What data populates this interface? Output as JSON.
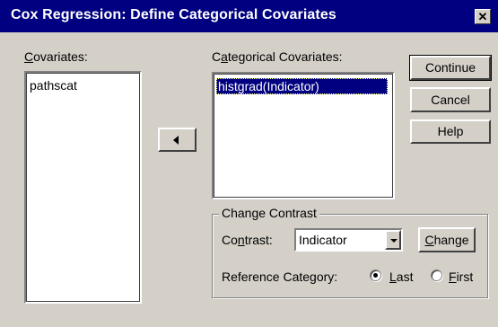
{
  "window": {
    "title": "Cox Regression: Define Categorical Covariates",
    "close_glyph": "✕"
  },
  "covariates": {
    "label_mnemonic": "C",
    "label_rest": "ovariates:",
    "items": [
      "pathscat"
    ]
  },
  "move_button": {
    "icon": "triangle-left-icon"
  },
  "categorical_covariates": {
    "label_prefix": "C",
    "label_mnemonic": "a",
    "label_rest": "tegorical Covariates:",
    "items": [
      "histgrad(Indicator)"
    ]
  },
  "buttons": {
    "continue": "Continue",
    "cancel": "Cancel",
    "help": "Help"
  },
  "change_contrast": {
    "group_label": "Change Contrast",
    "contrast_label_prefix": "Co",
    "contrast_label_mnemonic": "n",
    "contrast_label_rest": "trast:",
    "contrast_value": "Indicator",
    "change_button_mnemonic": "C",
    "change_button_rest": "hange",
    "reference_category_label": "Reference Category:",
    "last_label_mnemonic": "L",
    "last_label_rest": "ast",
    "first_label_mnemonic": "F",
    "first_label_rest": "irst",
    "selected_reference": "Last"
  }
}
